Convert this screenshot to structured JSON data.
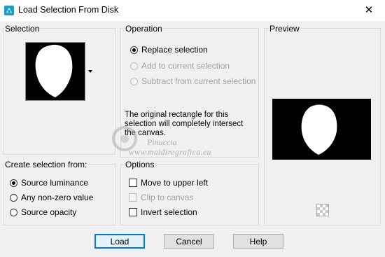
{
  "window": {
    "title": "Load Selection From Disk",
    "close_glyph": "✕"
  },
  "selection": {
    "label": "Selection"
  },
  "operation": {
    "label": "Operation",
    "options": [
      {
        "label": "Replace selection",
        "checked": true,
        "enabled": true
      },
      {
        "label": "Add to current selection",
        "checked": false,
        "enabled": false
      },
      {
        "label": "Subtract from current selection",
        "checked": false,
        "enabled": false
      }
    ],
    "info_lines": [
      "The original rectangle for this",
      "selection will completely intersect",
      "the canvas."
    ]
  },
  "preview": {
    "label": "Preview"
  },
  "create_from": {
    "label": "Create selection from:",
    "options": [
      {
        "label": "Source luminance",
        "checked": true
      },
      {
        "label": "Any non-zero value",
        "checked": false
      },
      {
        "label": "Source opacity",
        "checked": false
      }
    ]
  },
  "options": {
    "label": "Options",
    "items": [
      {
        "label": "Move to upper left",
        "checked": false,
        "enabled": true
      },
      {
        "label": "Clip to canvas",
        "checked": false,
        "enabled": false
      },
      {
        "label": "Invert selection",
        "checked": false,
        "enabled": true
      }
    ]
  },
  "watermark": {
    "name": "Pinuccia",
    "url": "www.maidiregrafica.eu"
  },
  "buttons": {
    "load": "Load",
    "cancel": "Cancel",
    "help": "Help"
  }
}
